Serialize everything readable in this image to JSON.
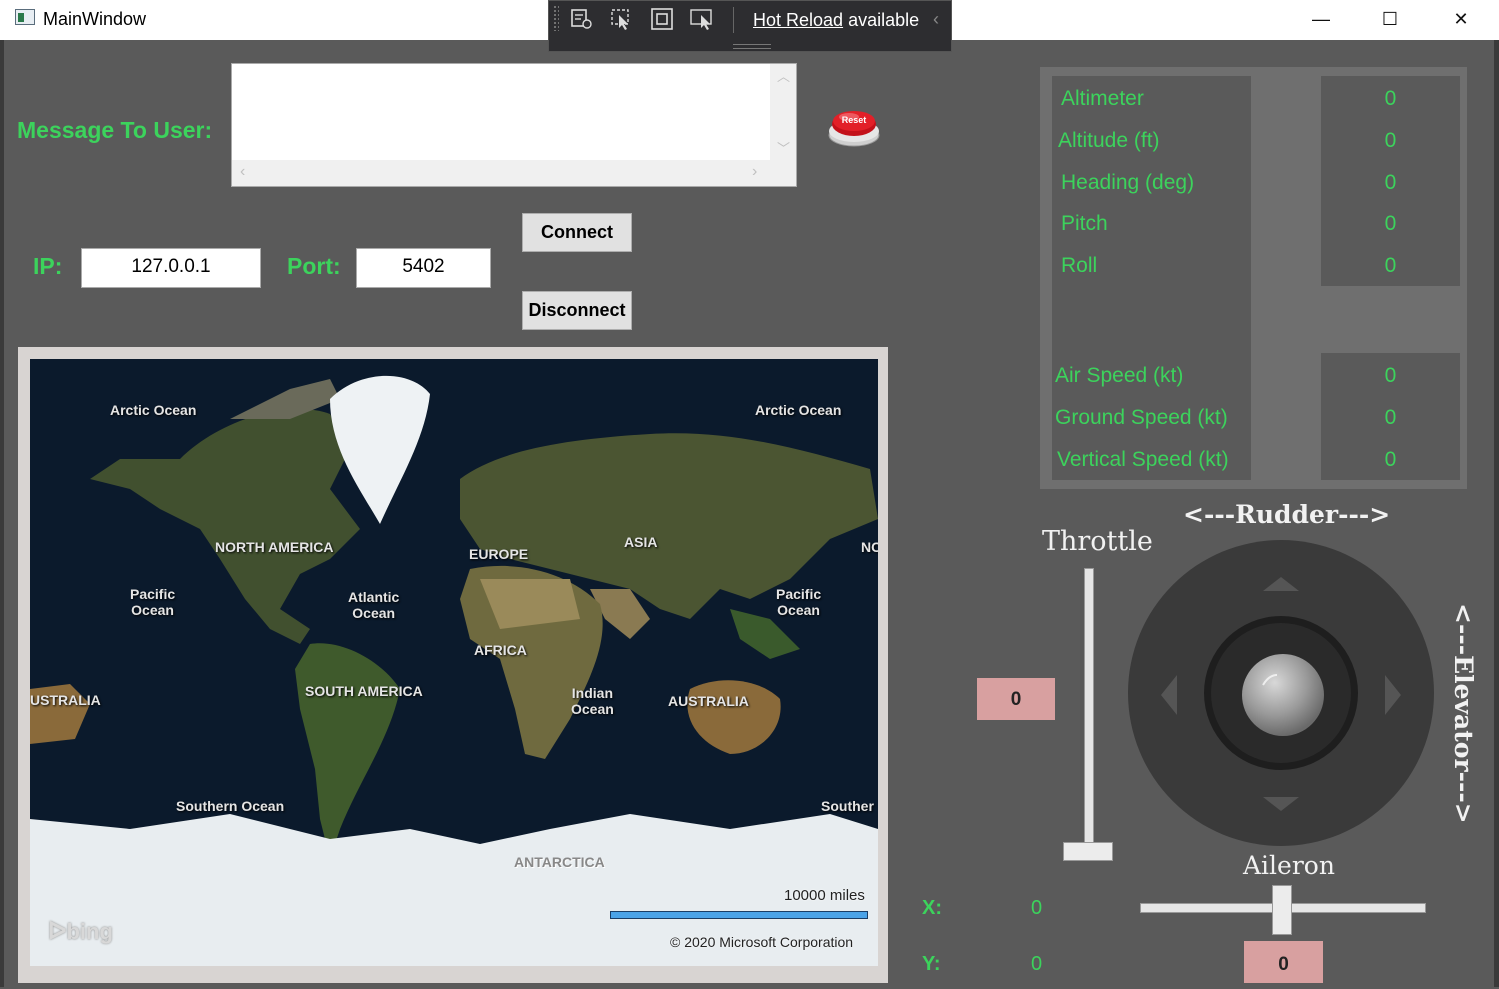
{
  "window": {
    "title": "MainWindow",
    "controls": {
      "minimize": "—",
      "maximize": "☐",
      "close": "✕"
    }
  },
  "hot_reload": {
    "link_text": "Hot Reload",
    "suffix_text": " available",
    "chevron": "‹"
  },
  "message": {
    "label": "Message To User:",
    "value": ""
  },
  "reset_button": {
    "label": "Reset",
    "color": "#d9141b"
  },
  "connection": {
    "ip_label": "IP:",
    "ip_value": "127.0.0.1",
    "port_label": "Port:",
    "port_value": "5402",
    "connect_label": "Connect",
    "disconnect_label": "Disconnect"
  },
  "map": {
    "labels": {
      "arctic_left": "Arctic Ocean",
      "arctic_right": "Arctic Ocean",
      "north_america": "NORTH AMERICA",
      "europe": "EUROPE",
      "asia": "ASIA",
      "na_right": "NC",
      "pacific_left": "Pacific\nOcean",
      "atlantic": "Atlantic\nOcean",
      "pacific_right": "Pacific\nOcean",
      "africa": "AFRICA",
      "australia_left": "USTRALIA",
      "south_america": "SOUTH AMERICA",
      "indian": "Indian\nOcean",
      "australia": "AUSTRALIA",
      "southern_left": "Southern Ocean",
      "southern_right": "Souther",
      "antarctica": "ANTARCTICA"
    },
    "scale_text": "10000 miles",
    "copyright": "© 2020 Microsoft Corporation",
    "provider": "bing",
    "ocean_color": "#0b1a2c",
    "land_color": "#3f4a2c",
    "ice_color": "#e8edf0"
  },
  "telemetry": {
    "group1": [
      {
        "name": "Altimeter",
        "value": "0"
      },
      {
        "name": "Altitude (ft)",
        "value": "0"
      },
      {
        "name": "Heading (deg)",
        "value": "0"
      },
      {
        "name": "Pitch",
        "value": "0"
      },
      {
        "name": "Roll",
        "value": "0"
      }
    ],
    "group2": [
      {
        "name": "Air Speed (kt)",
        "value": "0"
      },
      {
        "name": "Ground Speed (kt)",
        "value": "0"
      },
      {
        "name": "Vertical Speed (kt)",
        "value": "0"
      }
    ],
    "text_color": "#3cd35c"
  },
  "controls": {
    "throttle_label": "Throttle",
    "throttle_value": "0",
    "throttle_level": 0,
    "rudder_label": "<---Rudder--->",
    "elevator_label": "<---Elevator--->",
    "aileron_label": "Aileron",
    "aileron_value": "0",
    "x_label": "X:",
    "x_value": "0",
    "y_label": "Y:",
    "y_value": "0"
  }
}
